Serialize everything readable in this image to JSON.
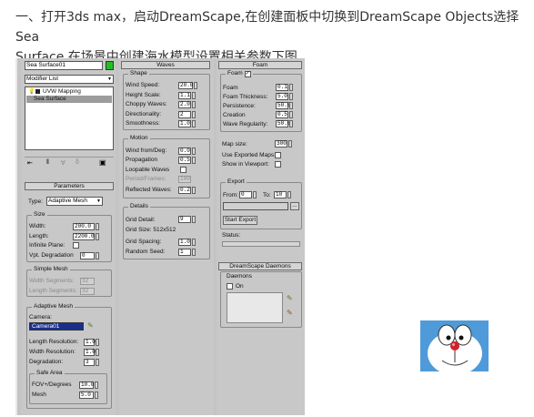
{
  "caption": {
    "line1": "一、打开3ds max，启动DreamScape,在创建面板中切换到DreamScape Objects选择Sea",
    "line2": "Surface 在场景中创建海水模型设置相关参数下图"
  },
  "left": {
    "object_name": "Sea Surface01",
    "modifier_list": "Modifier List",
    "stack": [
      "UVW Mapping",
      "Sea Surface"
    ],
    "parameters_title": "Parameters",
    "type_label": "Type:",
    "type_value": "Adaptive Mesh",
    "size_title": "Size",
    "width_label": "Width:",
    "width_value": "200.0",
    "length_label": "Length:",
    "length_value": "2200.0",
    "infinite_label": "Infinite Plane:",
    "vpt_label": "Vpt. Degradation",
    "vpt_value": "0",
    "simple_title": "Simple Mesh",
    "wseg_label": "Width Segments:",
    "wseg_value": "32",
    "lseg_label": "Length Segments:",
    "lseg_value": "32",
    "adaptive_title": "Adaptive Mesh",
    "camera_label": "Camera:",
    "camera_value": "Camera01",
    "lres_label": "Length Resolution:",
    "lres_value": "1.0",
    "wres_label": "Width Resolution:",
    "wres_value": "1.0",
    "deg_label": "Degradation:",
    "deg_value": "3",
    "safe_title": "Safe Area",
    "fov_label": "FOV+/Degrees",
    "fov_value": "10.0",
    "mesh_label": "Mesh",
    "mesh_value": "5.0"
  },
  "waves": {
    "title": "Waves",
    "shape_title": "Shape",
    "wind_speed_label": "Wind Speed:",
    "wind_speed_value": "20.0",
    "height_label": "Height Scale:",
    "height_value": "1.1",
    "choppy_label": "Choppy Waves:",
    "choppy_value": "2.0",
    "direct_label": "Directionality:",
    "direct_value": "2",
    "smooth_label": "Smoothness:",
    "smooth_value": "1.0",
    "motion_title": "Motion",
    "winddeg_label": "Wind from/Deg:",
    "winddeg_value": "0.0",
    "prop_label": "Propagation",
    "prop_value": "0.5",
    "loop_label": "Loopable Waves",
    "period_label": "Period/Frames:",
    "period_value": "100",
    "refl_label": "Reflected Waves:",
    "refl_value": "0.2",
    "details_title": "Details",
    "grid_label": "Grid Detail:",
    "grid_value": "9",
    "gridsize_label": "Grid Size: 512x512",
    "spacing_label": "Grid Spacing:",
    "spacing_value": "1.0",
    "seed_label": "Random Seed:",
    "seed_value": "1"
  },
  "foam": {
    "title": "Foam",
    "foam_group": "Foam",
    "foam_label": "Foam",
    "foam_value": "0.1",
    "thick_label": "Foam Thickness:",
    "thick_value": "5.0",
    "persist_label": "Persistence:",
    "persist_value": "50.0",
    "creation_label": "Creation",
    "creation_value": "0.5",
    "regular_label": "Wave Regularity:",
    "regular_value": "50.0",
    "mapsize_label": "Map size:",
    "mapsize_value": "300",
    "useexp_label": "Use Exported Maps:",
    "showvp_label": "Show in Viewport:",
    "export_title": "Export",
    "from_label": "From:",
    "from_value": "0",
    "to_label": "To:",
    "to_value": "10",
    "browse": "...",
    "start_export": "Start Export",
    "status_label": "Status:"
  },
  "daemons": {
    "title": "DreamScape Daemons",
    "group": "Daemons",
    "on_label": "On"
  },
  "colors": {
    "panel": "#c8c8c8",
    "header": "#d4d4d4",
    "field": "#ffffff",
    "selection": "#1a2f8c",
    "swatch_green": "#21c021"
  }
}
